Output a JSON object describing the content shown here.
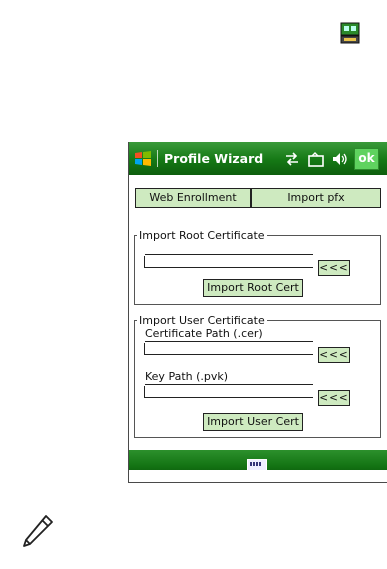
{
  "window": {
    "title": "Profile Wizard",
    "ok_label": "ok"
  },
  "tabs": {
    "web_enrollment": "Web Enrollment",
    "import_pfx": "Import pfx"
  },
  "root_cert": {
    "group_label": "Import Root Certificate",
    "path_value": "",
    "browse_label": "<<<",
    "import_label": "Import Root Cert"
  },
  "user_cert": {
    "group_label": "Import User Certificate",
    "cert_path_label": "Certificate Path (.cer)",
    "cert_path_value": "",
    "cert_browse_label": "<<<",
    "key_path_label": "Key Path (.pvk)",
    "key_path_value": "",
    "key_browse_label": "<<<",
    "import_label": "Import User Cert"
  },
  "icons": {
    "top_right": "network-status-icon",
    "title_flag": "windows-flag-icon",
    "connectivity": "connectivity-arrows-icon",
    "signal": "signal-icon",
    "speaker": "speaker-icon",
    "keyboard": "keyboard-icon",
    "note": "pencil-note-icon"
  },
  "colors": {
    "titlebar": "#157815",
    "button_bg": "#ceeac0",
    "ok_bg": "#5fd25f"
  }
}
